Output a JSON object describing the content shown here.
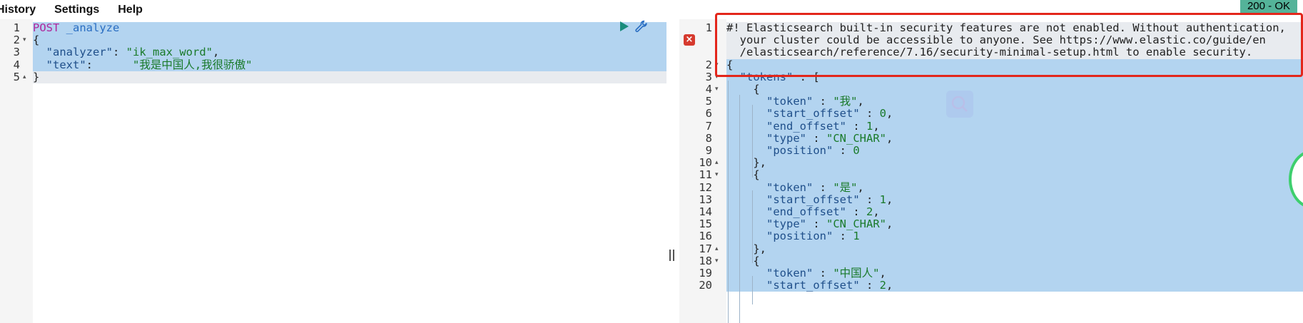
{
  "menu": {
    "history": "History",
    "settings": "Settings",
    "help": "Help"
  },
  "status": "200 - OK",
  "request": {
    "lines": [
      {
        "n": "1",
        "fold": "",
        "parts": [
          [
            "kw",
            "POST"
          ],
          [
            "pun",
            " "
          ],
          [
            "path",
            "_analyze"
          ]
        ]
      },
      {
        "n": "2",
        "fold": "▾",
        "parts": [
          [
            "pun",
            "{"
          ]
        ]
      },
      {
        "n": "3",
        "fold": "",
        "parts": [
          [
            "pun",
            "  "
          ],
          [
            "key",
            "\"analyzer\""
          ],
          [
            "pun",
            ": "
          ],
          [
            "str",
            "\"ik_max_word\""
          ],
          [
            "pun",
            ","
          ]
        ]
      },
      {
        "n": "4",
        "fold": "",
        "parts": [
          [
            "pun",
            "  "
          ],
          [
            "key",
            "\"text\""
          ],
          [
            "pun",
            ":      "
          ],
          [
            "str",
            "\"我是中国人,我很骄傲\""
          ]
        ]
      },
      {
        "n": "5",
        "fold": "▴",
        "parts": [
          [
            "pun",
            "}"
          ]
        ]
      }
    ]
  },
  "response": {
    "lines": [
      {
        "n": "1",
        "fold": "",
        "parts": [
          [
            "cmt",
            "#! Elasticsearch built-in security features are not enabled. Without authentication,"
          ]
        ]
      },
      {
        "n": "",
        "fold": "",
        "parts": [
          [
            "cmt",
            "  your cluster could be accessible to anyone. See https://www.elastic.co/guide/en"
          ]
        ]
      },
      {
        "n": "",
        "fold": "",
        "parts": [
          [
            "cmt",
            "  /elasticsearch/reference/7.16/security-minimal-setup.html to enable security."
          ]
        ]
      },
      {
        "n": "2",
        "fold": "▾",
        "parts": [
          [
            "pun",
            "{"
          ]
        ]
      },
      {
        "n": "3",
        "fold": "▾",
        "parts": [
          [
            "pun",
            "  "
          ],
          [
            "key",
            "\"tokens\""
          ],
          [
            "pun",
            " : ["
          ]
        ]
      },
      {
        "n": "4",
        "fold": "▾",
        "parts": [
          [
            "pun",
            "    {"
          ]
        ]
      },
      {
        "n": "5",
        "fold": "",
        "parts": [
          [
            "pun",
            "      "
          ],
          [
            "key",
            "\"token\""
          ],
          [
            "pun",
            " : "
          ],
          [
            "str",
            "\"我\""
          ],
          [
            "pun",
            ","
          ]
        ]
      },
      {
        "n": "6",
        "fold": "",
        "parts": [
          [
            "pun",
            "      "
          ],
          [
            "key",
            "\"start_offset\""
          ],
          [
            "pun",
            " : "
          ],
          [
            "num",
            "0"
          ],
          [
            "pun",
            ","
          ]
        ]
      },
      {
        "n": "7",
        "fold": "",
        "parts": [
          [
            "pun",
            "      "
          ],
          [
            "key",
            "\"end_offset\""
          ],
          [
            "pun",
            " : "
          ],
          [
            "num",
            "1"
          ],
          [
            "pun",
            ","
          ]
        ]
      },
      {
        "n": "8",
        "fold": "",
        "parts": [
          [
            "pun",
            "      "
          ],
          [
            "key",
            "\"type\""
          ],
          [
            "pun",
            " : "
          ],
          [
            "str",
            "\"CN_CHAR\""
          ],
          [
            "pun",
            ","
          ]
        ]
      },
      {
        "n": "9",
        "fold": "",
        "parts": [
          [
            "pun",
            "      "
          ],
          [
            "key",
            "\"position\""
          ],
          [
            "pun",
            " : "
          ],
          [
            "num",
            "0"
          ]
        ]
      },
      {
        "n": "10",
        "fold": "▴",
        "parts": [
          [
            "pun",
            "    },"
          ]
        ]
      },
      {
        "n": "11",
        "fold": "▾",
        "parts": [
          [
            "pun",
            "    {"
          ]
        ]
      },
      {
        "n": "12",
        "fold": "",
        "parts": [
          [
            "pun",
            "      "
          ],
          [
            "key",
            "\"token\""
          ],
          [
            "pun",
            " : "
          ],
          [
            "str",
            "\"是\""
          ],
          [
            "pun",
            ","
          ]
        ]
      },
      {
        "n": "13",
        "fold": "",
        "parts": [
          [
            "pun",
            "      "
          ],
          [
            "key",
            "\"start_offset\""
          ],
          [
            "pun",
            " : "
          ],
          [
            "num",
            "1"
          ],
          [
            "pun",
            ","
          ]
        ]
      },
      {
        "n": "14",
        "fold": "",
        "parts": [
          [
            "pun",
            "      "
          ],
          [
            "key",
            "\"end_offset\""
          ],
          [
            "pun",
            " : "
          ],
          [
            "num",
            "2"
          ],
          [
            "pun",
            ","
          ]
        ]
      },
      {
        "n": "15",
        "fold": "",
        "parts": [
          [
            "pun",
            "      "
          ],
          [
            "key",
            "\"type\""
          ],
          [
            "pun",
            " : "
          ],
          [
            "str",
            "\"CN_CHAR\""
          ],
          [
            "pun",
            ","
          ]
        ]
      },
      {
        "n": "16",
        "fold": "",
        "parts": [
          [
            "pun",
            "      "
          ],
          [
            "key",
            "\"position\""
          ],
          [
            "pun",
            " : "
          ],
          [
            "num",
            "1"
          ]
        ]
      },
      {
        "n": "17",
        "fold": "▴",
        "parts": [
          [
            "pun",
            "    },"
          ]
        ]
      },
      {
        "n": "18",
        "fold": "▾",
        "parts": [
          [
            "pun",
            "    {"
          ]
        ]
      },
      {
        "n": "19",
        "fold": "",
        "parts": [
          [
            "pun",
            "      "
          ],
          [
            "key",
            "\"token\""
          ],
          [
            "pun",
            " : "
          ],
          [
            "str",
            "\"中国人\""
          ],
          [
            "pun",
            ","
          ]
        ]
      },
      {
        "n": "20",
        "fold": "",
        "parts": [
          [
            "pun",
            "      "
          ],
          [
            "key",
            "\"start_offset\""
          ],
          [
            "pun",
            " : "
          ],
          [
            "num",
            "2"
          ],
          [
            "pun",
            ","
          ]
        ]
      }
    ]
  },
  "icons": {
    "play": "play-icon",
    "wrench": "wrench-icon",
    "error": "error-icon",
    "search": "search-icon"
  },
  "colors": {
    "selection": "#b3d4f0",
    "status_bg": "#54b399",
    "highlight_border": "#e3261b",
    "error": "#d63a2e"
  }
}
